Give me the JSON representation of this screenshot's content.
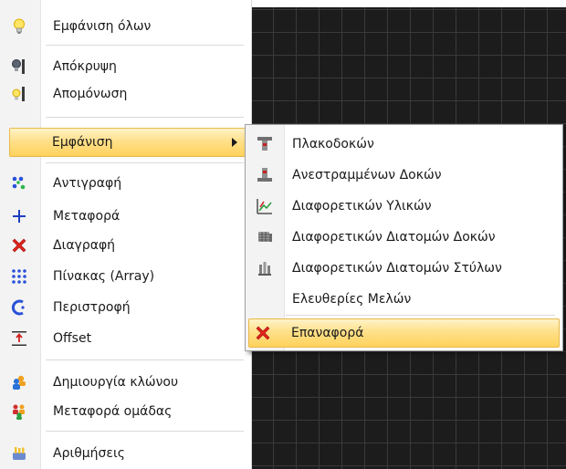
{
  "main_menu": {
    "items": [
      {
        "label": "Εμφάνιση όλων",
        "icon": "lightbulb-icon"
      },
      {
        "label": "Απόκρυψη",
        "icon": "hide-bulb-icon"
      },
      {
        "label": "Απομόνωση",
        "icon": "isolate-bulb-icon"
      },
      {
        "label": "Εμφάνιση",
        "icon": "none"
      },
      {
        "label": "Αντιγραφή",
        "icon": "copy-dots-icon"
      },
      {
        "label": "Μεταφορά",
        "icon": "move-icon"
      },
      {
        "label": "Διαγραφή",
        "icon": "delete-icon"
      },
      {
        "label": "Πίνακας (Array)",
        "icon": "array-grid-icon"
      },
      {
        "label": "Περιστροφή",
        "icon": "rotate-icon"
      },
      {
        "label": "Offset",
        "icon": "offset-icon"
      },
      {
        "label": "Δημιουργία κλώνου",
        "icon": "clone-icon"
      },
      {
        "label": "Μεταφορά ομάδας",
        "icon": "move-group-icon"
      },
      {
        "label": "Αριθμήσεις",
        "icon": "numbering-icon"
      }
    ]
  },
  "sub_menu": {
    "items": [
      {
        "label": "Πλακοδοκών",
        "icon": "slab-beam-icon"
      },
      {
        "label": "Ανεστραμμένων Δοκών",
        "icon": "inverted-beam-icon"
      },
      {
        "label": "Διαφορετικών Υλικών",
        "icon": "materials-icon"
      },
      {
        "label": "Διαφορετικών Διατομών Δοκών",
        "icon": "beam-sections-icon"
      },
      {
        "label": "Διαφορετικών Διατομών Στύλων",
        "icon": "column-sections-icon"
      },
      {
        "label": "Ελευθερίες Μελών",
        "icon": "none"
      },
      {
        "label": "Επαναφορά",
        "icon": "reset-icon"
      }
    ]
  },
  "colors": {
    "highlight": "#ffd25c",
    "canvas": "#1c1c1c",
    "delete_red": "#e0241b",
    "move_blue": "#1f3fbf"
  }
}
